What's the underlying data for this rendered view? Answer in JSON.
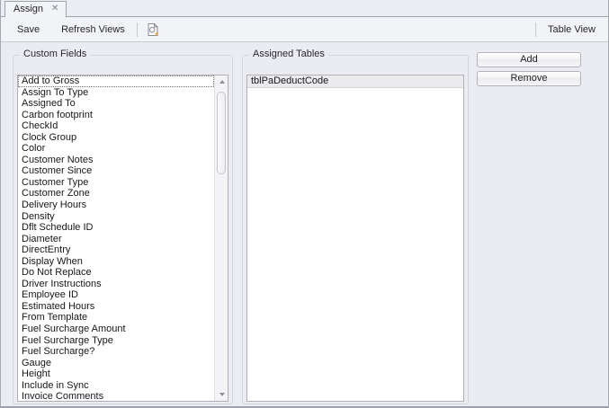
{
  "tab": {
    "title": "Assign"
  },
  "toolbar": {
    "save": "Save",
    "refresh_views": "Refresh Views",
    "table_view": "Table View"
  },
  "custom_fields": {
    "title": "Custom Fields",
    "items": [
      "Add to Gross",
      "Assign To Type",
      "Assigned To",
      "Carbon footprint",
      "CheckId",
      "Clock Group",
      "Color",
      "Customer Notes",
      "Customer Since",
      "Customer Type",
      "Customer Zone",
      "Delivery Hours",
      "Density",
      "Dflt Schedule ID",
      "Diameter",
      "DirectEntry",
      "Display When",
      "Do Not Replace",
      "Driver Instructions",
      "Employee ID",
      "Estimated Hours",
      "From Template",
      "Fuel Surcharge Amount",
      "Fuel Surcharge Type",
      "Fuel Surcharge?",
      "Gauge",
      "Height",
      "Include in Sync",
      "Invoice Comments"
    ]
  },
  "assigned_tables": {
    "title": "Assigned Tables",
    "items": [
      "tblPaDeductCode"
    ]
  },
  "actions": {
    "add": "Add",
    "remove": "Remove"
  },
  "icons": {
    "tab_close": "✕",
    "print_preview": "document-with-magnifier-and-orange-star"
  },
  "colors": {
    "panel": "#ebecf1",
    "toolbar": "#f2f3f7",
    "window_border": "#a6a7b1",
    "group_border": "#d3d4dc",
    "list_border": "#afb0b8",
    "selection_gray": "#ebebee",
    "accent_orange": "#e8a33d"
  }
}
